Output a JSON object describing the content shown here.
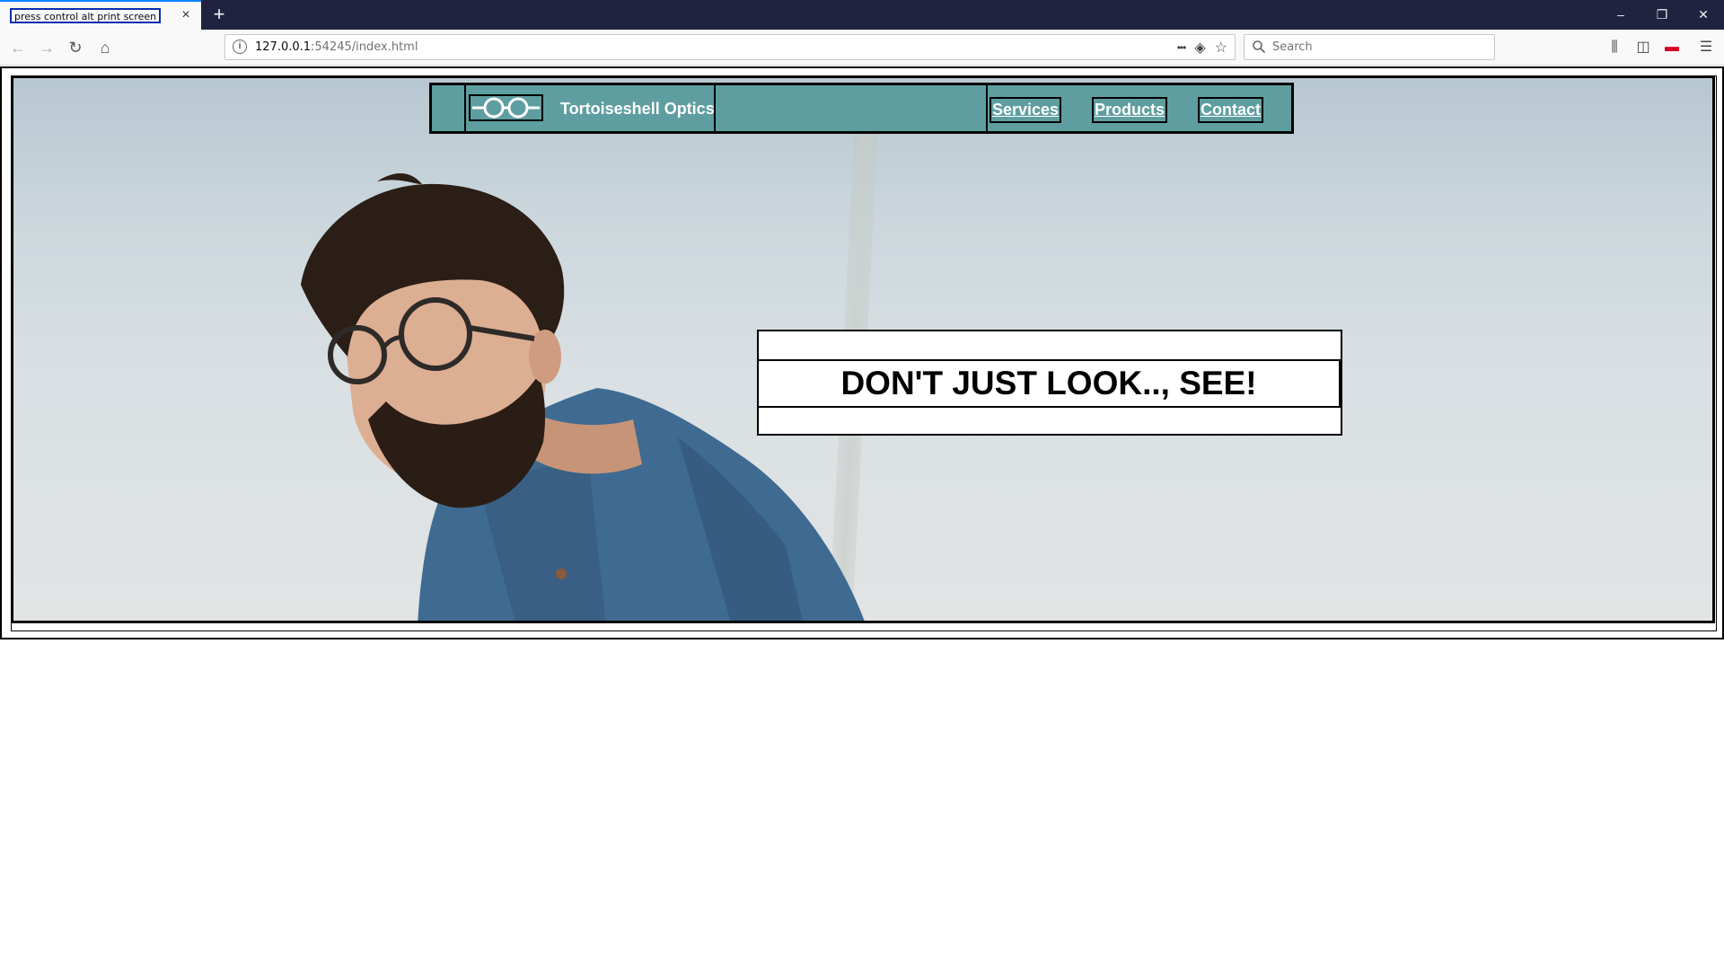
{
  "browser": {
    "tab_title": "press control alt print screen",
    "tab_close_icon": "×",
    "new_tab_icon": "+",
    "url_host": "127.0.0.1",
    "url_port_path": ":54245/index.html",
    "search_placeholder": "Search",
    "window_controls": {
      "minimize": "–",
      "restore": "❐",
      "close": "✕"
    },
    "nav": {
      "back": "←",
      "forward": "→",
      "reload": "↻",
      "home": "⌂"
    },
    "url_actions": {
      "more": "•••",
      "pocket": "◈",
      "bookmark": "☆"
    },
    "toolbar_icons": {
      "library": "⫼",
      "sidebar": "◫",
      "addon": "▬",
      "menu": "☰"
    }
  },
  "site": {
    "brand_name": "Tortoiseshell Optics",
    "logo_icon": "glasses-icon",
    "menu": [
      {
        "label": "Services"
      },
      {
        "label": "Products"
      },
      {
        "label": "Contact"
      }
    ],
    "tagline": "DON'T JUST LOOK.., SEE!",
    "colors": {
      "header_bg": "#5f9ea0",
      "text_light": "#ffffff",
      "border": "#000000"
    }
  }
}
